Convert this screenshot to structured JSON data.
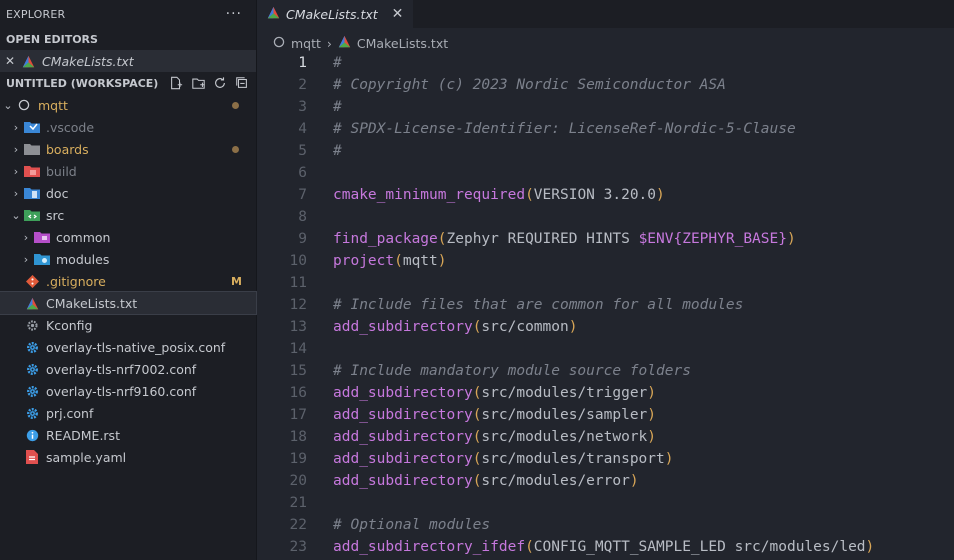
{
  "sidebar": {
    "title": "EXPLORER",
    "more": "···",
    "open_editors_label": "OPEN EDITORS",
    "open_editor_file": "CMakeLists.txt",
    "workspace_label": "UNTITLED (WORKSPACE)",
    "root_folder": "mqtt",
    "items": [
      {
        "label": ".vscode"
      },
      {
        "label": "boards"
      },
      {
        "label": "build"
      },
      {
        "label": "doc"
      },
      {
        "label": "src"
      },
      {
        "label": "common"
      },
      {
        "label": "modules"
      },
      {
        "label": ".gitignore",
        "badge": "M"
      },
      {
        "label": "CMakeLists.txt"
      },
      {
        "label": "Kconfig"
      },
      {
        "label": "overlay-tls-native_posix.conf"
      },
      {
        "label": "overlay-tls-nrf7002.conf"
      },
      {
        "label": "overlay-tls-nrf9160.conf"
      },
      {
        "label": "prj.conf"
      },
      {
        "label": "README.rst"
      },
      {
        "label": "sample.yaml"
      }
    ]
  },
  "tab": {
    "label": "CMakeLists.txt",
    "close": "✕"
  },
  "breadcrumb": {
    "folder": "mqtt",
    "sep": "›",
    "file": "CMakeLists.txt"
  },
  "code": {
    "active_line": 1,
    "lines": [
      {
        "n": "1",
        "t": "#"
      },
      {
        "n": "2",
        "t": "# Copyright (c) 2023 Nordic Semiconductor ASA"
      },
      {
        "n": "3",
        "t": "#"
      },
      {
        "n": "4",
        "t": "# SPDX-License-Identifier: LicenseRef-Nordic-5-Clause"
      },
      {
        "n": "5",
        "t": "#"
      },
      {
        "n": "6",
        "t": ""
      },
      {
        "n": "7",
        "t": "cmake_minimum_required(VERSION 3.20.0)"
      },
      {
        "n": "8",
        "t": ""
      },
      {
        "n": "9",
        "t": "find_package(Zephyr REQUIRED HINTS $ENV{ZEPHYR_BASE})"
      },
      {
        "n": "10",
        "t": "project(mqtt)"
      },
      {
        "n": "11",
        "t": ""
      },
      {
        "n": "12",
        "t": "# Include files that are common for all modules"
      },
      {
        "n": "13",
        "t": "add_subdirectory(src/common)"
      },
      {
        "n": "14",
        "t": ""
      },
      {
        "n": "15",
        "t": "# Include mandatory module source folders"
      },
      {
        "n": "16",
        "t": "add_subdirectory(src/modules/trigger)"
      },
      {
        "n": "17",
        "t": "add_subdirectory(src/modules/sampler)"
      },
      {
        "n": "18",
        "t": "add_subdirectory(src/modules/network)"
      },
      {
        "n": "19",
        "t": "add_subdirectory(src/modules/transport)"
      },
      {
        "n": "20",
        "t": "add_subdirectory(src/modules/error)"
      },
      {
        "n": "21",
        "t": ""
      },
      {
        "n": "22",
        "t": "# Optional modules"
      },
      {
        "n": "23",
        "t": "add_subdirectory_ifdef(CONFIG_MQTT_SAMPLE_LED src/modules/led)"
      }
    ]
  }
}
